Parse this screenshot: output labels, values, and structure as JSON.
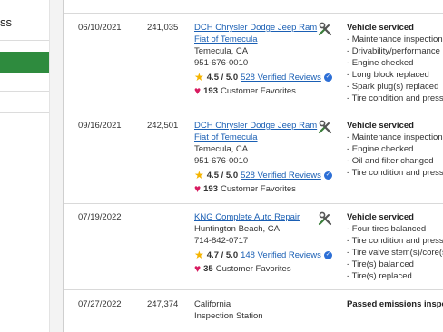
{
  "sidebar": {
    "title_fragment": "ss"
  },
  "records": [
    {
      "date": "06/10/2021",
      "mileage": "241,035",
      "shop_name_line1": "DCH Chrysler Dodge Jeep Ram",
      "shop_name_line2": "Fiat of Temecula",
      "location": "Temecula, CA",
      "phone": "951-676-0010",
      "rating": "4.5 / 5.0",
      "reviews": "528 Verified Reviews",
      "favorites_count": "193",
      "favorites_label": "Customer Favorites",
      "service_heading": "Vehicle serviced",
      "services": [
        "- Maintenance inspection co",
        "- Drivability/performance ch",
        "- Engine checked",
        "- Long block replaced",
        "- Spark plug(s) replaced",
        "- Tire condition and pressure"
      ]
    },
    {
      "date": "09/16/2021",
      "mileage": "242,501",
      "shop_name_line1": "DCH Chrysler Dodge Jeep Ram",
      "shop_name_line2": "Fiat of Temecula",
      "location": "Temecula, CA",
      "phone": "951-676-0010",
      "rating": "4.5 / 5.0",
      "reviews": "528 Verified Reviews",
      "favorites_count": "193",
      "favorites_label": "Customer Favorites",
      "service_heading": "Vehicle serviced",
      "services": [
        "- Maintenance inspection co",
        "- Engine checked",
        "- Oil and filter changed",
        "- Tire condition and pressure"
      ]
    },
    {
      "date": "07/19/2022",
      "mileage": "",
      "shop_name_line1": "KNG Complete Auto Repair",
      "location": "Huntington Beach, CA",
      "phone": "714-842-0717",
      "rating": "4.7 / 5.0",
      "reviews": "148 Verified Reviews",
      "favorites_count": "35",
      "favorites_label": "Customer Favorites",
      "service_heading": "Vehicle serviced",
      "services": [
        "- Four tires balanced",
        "- Tire condition and pressure",
        "- Tire valve stem(s)/core(s)",
        "- Tire(s) balanced",
        "- Tire(s) replaced"
      ]
    },
    {
      "date": "07/27/2022",
      "mileage": "247,374",
      "shop_line1": "California",
      "shop_line2": "Inspection Station",
      "service_heading": "Passed emissions inspectio"
    }
  ],
  "colors": {
    "accent_green": "#2e8b3e",
    "link_blue": "#1a5fb4",
    "star": "#f5b400",
    "heart": "#d81b60"
  },
  "icons": [
    "tools-icon",
    "star-icon",
    "verified-badge-icon",
    "heart-icon"
  ]
}
